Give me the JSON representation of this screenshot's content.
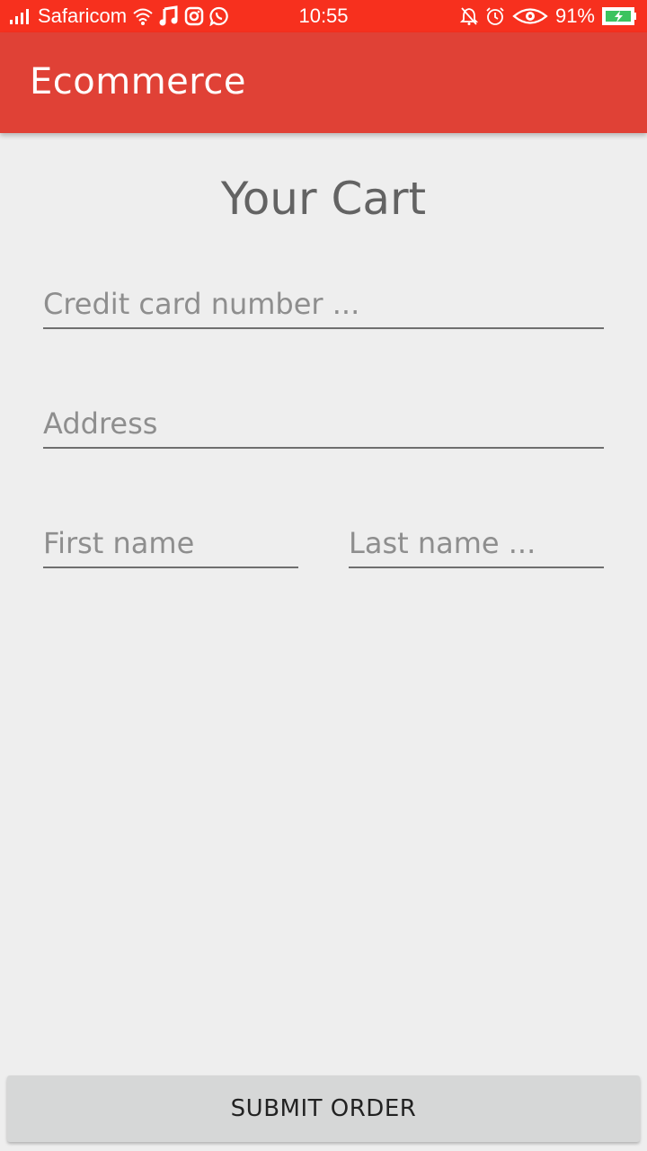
{
  "status_bar": {
    "carrier": "Safaricom",
    "time": "10:55",
    "battery_percent": "91%",
    "background_color": "#f7301e",
    "icons_left": [
      "signal-icon",
      "wifi-icon",
      "music-icon",
      "instagram-icon",
      "whatsapp-icon"
    ],
    "icons_right": [
      "bell-off-icon",
      "alarm-icon",
      "eye-icon",
      "battery-charging-icon"
    ]
  },
  "app_bar": {
    "title": "Ecommerce",
    "background_color": "#e04136"
  },
  "page": {
    "heading": "Your Cart"
  },
  "form": {
    "credit_card_placeholder": "Credit card number ...",
    "credit_card_value": "",
    "address_placeholder": "Address",
    "address_value": "",
    "first_name_placeholder": "First name",
    "first_name_value": "",
    "last_name_placeholder": "Last name ...",
    "last_name_value": ""
  },
  "actions": {
    "submit_label": "SUBMIT ORDER"
  }
}
